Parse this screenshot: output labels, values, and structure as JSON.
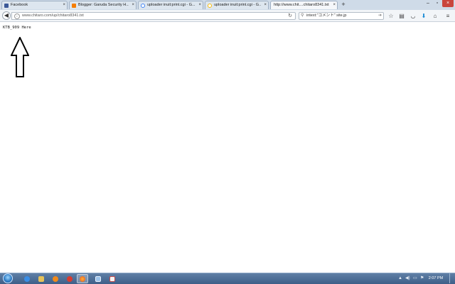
{
  "tabs": [
    {
      "label": "Facebook",
      "favicon": "facebook-icon",
      "color": "#3b5998"
    },
    {
      "label": "Blogger: Garuda Security H...",
      "favicon": "blogger-icon",
      "color": "#f57d00"
    },
    {
      "label": "uploader inuit:print.cgi - G...",
      "favicon": "google-icon",
      "color": "#4285f4"
    },
    {
      "label": "uploader inuit:print.cgi - G...",
      "favicon": "google-icon",
      "color": "#4285f4"
    },
    {
      "label": "http://www.chit....chitaro8341.txt",
      "favicon": "",
      "color": "#ffffff"
    }
  ],
  "active_tab": 4,
  "navbar": {
    "url": "www.chitaro.com/up/chitaro8341.txt",
    "search_value": "intext:\"コメント\" site.jp"
  },
  "page": {
    "text": "KTB_909 Here"
  },
  "taskbar": {
    "clock": "2:07 PM"
  },
  "colors": {
    "titlebar": "#cfdbe8",
    "taskbar": "#4a6c96",
    "facebook": "#3b5998",
    "blogger": "#f57d00"
  }
}
